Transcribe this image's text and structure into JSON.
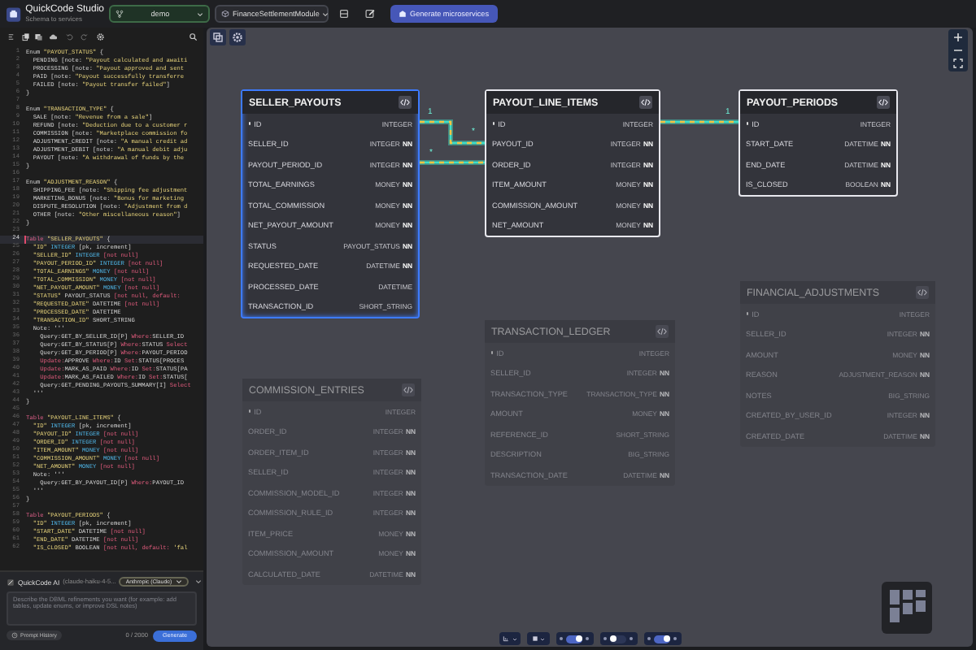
{
  "app": {
    "title": "QuickCode Studio",
    "subtitle": "Schema to services"
  },
  "topbar": {
    "branch": "demo",
    "module": "FinanceSettlementModule",
    "generate_button": "Generate microservices"
  },
  "code_lines": [
    {
      "n": "1",
      "current": false,
      "s": [
        {
          "text": "Enum ",
          "kind": "plain"
        },
        {
          "text": "\"PAYOUT_STATUS\"",
          "kind": "string"
        },
        {
          "text": " {",
          "kind": "plain"
        }
      ]
    },
    {
      "n": "2",
      "current": false,
      "s": [
        {
          "text": "  PENDING [note: ",
          "kind": "plain"
        },
        {
          "text": "\"Payout calculated and awaiti",
          "kind": "string"
        }
      ]
    },
    {
      "n": "3",
      "current": false,
      "s": [
        {
          "text": "  PROCESSING [note: ",
          "kind": "plain"
        },
        {
          "text": "\"Payout approved and sent",
          "kind": "string"
        }
      ]
    },
    {
      "n": "4",
      "current": false,
      "s": [
        {
          "text": "  PAID [note: ",
          "kind": "plain"
        },
        {
          "text": "\"Payout successfully transferre",
          "kind": "string"
        }
      ]
    },
    {
      "n": "5",
      "current": false,
      "s": [
        {
          "text": "  FAILED [note: ",
          "kind": "plain"
        },
        {
          "text": "\"Payout transfer failed\"",
          "kind": "string"
        },
        {
          "text": "]",
          "kind": "plain"
        }
      ]
    },
    {
      "n": "6",
      "current": false,
      "s": [
        {
          "text": "}",
          "kind": "plain"
        }
      ]
    },
    {
      "n": "7",
      "current": false
    },
    {
      "n": "8",
      "current": false,
      "s": [
        {
          "text": "Enum ",
          "kind": "plain"
        },
        {
          "text": "\"TRANSACTION_TYPE\"",
          "kind": "string"
        },
        {
          "text": " {",
          "kind": "plain"
        }
      ]
    },
    {
      "n": "9",
      "current": false,
      "s": [
        {
          "text": "  SALE [note: ",
          "kind": "plain"
        },
        {
          "text": "\"Revenue from a sale\"",
          "kind": "string"
        },
        {
          "text": "]",
          "kind": "plain"
        }
      ]
    },
    {
      "n": "10",
      "current": false,
      "s": [
        {
          "text": "  REFUND [note: ",
          "kind": "plain"
        },
        {
          "text": "\"Deduction due to a customer r",
          "kind": "string"
        }
      ]
    },
    {
      "n": "11",
      "current": false,
      "s": [
        {
          "text": "  COMMISSION [note: ",
          "kind": "plain"
        },
        {
          "text": "\"Marketplace commission fo",
          "kind": "string"
        }
      ]
    },
    {
      "n": "12",
      "current": false,
      "s": [
        {
          "text": "  ADJUSTMENT_CREDIT [note: ",
          "kind": "plain"
        },
        {
          "text": "\"A manual credit ad",
          "kind": "string"
        }
      ]
    },
    {
      "n": "13",
      "current": false,
      "s": [
        {
          "text": "  ADJUSTMENT_DEBIT [note: ",
          "kind": "plain"
        },
        {
          "text": "\"A manual debit adju",
          "kind": "string"
        }
      ]
    },
    {
      "n": "14",
      "current": false,
      "s": [
        {
          "text": "  PAYOUT [note: ",
          "kind": "plain"
        },
        {
          "text": "\"A withdrawal of funds by the",
          "kind": "string"
        }
      ]
    },
    {
      "n": "15",
      "current": false,
      "s": [
        {
          "text": "}",
          "kind": "plain"
        }
      ]
    },
    {
      "n": "16",
      "current": false
    },
    {
      "n": "17",
      "current": false,
      "s": [
        {
          "text": "Enum ",
          "kind": "plain"
        },
        {
          "text": "\"ADJUSTMENT_REASON\"",
          "kind": "string"
        },
        {
          "text": " {",
          "kind": "plain"
        }
      ]
    },
    {
      "n": "18",
      "current": false,
      "s": [
        {
          "text": "  SHIPPING_FEE [note: ",
          "kind": "plain"
        },
        {
          "text": "\"Shipping fee adjustment",
          "kind": "string"
        }
      ]
    },
    {
      "n": "19",
      "current": false,
      "s": [
        {
          "text": "  MARKETING_BONUS [note: ",
          "kind": "plain"
        },
        {
          "text": "\"Bonus for marketing",
          "kind": "string"
        }
      ]
    },
    {
      "n": "20",
      "current": false,
      "s": [
        {
          "text": "  DISPUTE_RESOLUTION [note: ",
          "kind": "plain"
        },
        {
          "text": "\"Adjustment from d",
          "kind": "string"
        }
      ]
    },
    {
      "n": "21",
      "current": false,
      "s": [
        {
          "text": "  OTHER [note: ",
          "kind": "plain"
        },
        {
          "text": "\"Other miscellaneous reason\"",
          "kind": "string"
        },
        {
          "text": "]",
          "kind": "plain"
        }
      ]
    },
    {
      "n": "22",
      "current": false,
      "s": [
        {
          "text": "}",
          "kind": "plain"
        }
      ]
    },
    {
      "n": "23",
      "current": false
    },
    {
      "n": "24",
      "current": true,
      "s": [
        {
          "text": "Table ",
          "kind": "keyword"
        },
        {
          "text": "\"SELLER_PAYOUTS\"",
          "kind": "string"
        },
        {
          "text": " {",
          "kind": "plain"
        }
      ]
    },
    {
      "n": "25",
      "current": false,
      "s": [
        {
          "text": "  \"ID\" ",
          "kind": "string"
        },
        {
          "text": "INTEGER",
          "kind": "type"
        },
        {
          "text": " [pk, increment]",
          "kind": "plain"
        }
      ]
    },
    {
      "n": "26",
      "current": false,
      "s": [
        {
          "text": "  \"SELLER_ID\" ",
          "kind": "string"
        },
        {
          "text": "INTEGER",
          "kind": "type"
        },
        {
          "text": " [not null]",
          "kind": "constraint"
        }
      ]
    },
    {
      "n": "27",
      "current": false,
      "s": [
        {
          "text": "  \"PAYOUT_PERIOD_ID\" ",
          "kind": "string"
        },
        {
          "text": "INTEGER",
          "kind": "type"
        },
        {
          "text": " [not null]",
          "kind": "constraint"
        }
      ]
    },
    {
      "n": "28",
      "current": false,
      "s": [
        {
          "text": "  \"TOTAL_EARNINGS\" ",
          "kind": "string"
        },
        {
          "text": "MONEY",
          "kind": "type"
        },
        {
          "text": " [not null]",
          "kind": "constraint"
        }
      ]
    },
    {
      "n": "29",
      "current": false,
      "s": [
        {
          "text": "  \"TOTAL_COMMISSION\" ",
          "kind": "string"
        },
        {
          "text": "MONEY",
          "kind": "type"
        },
        {
          "text": " [not null]",
          "kind": "constraint"
        }
      ]
    },
    {
      "n": "30",
      "current": false,
      "s": [
        {
          "text": "  \"NET_PAYOUT_AMOUNT\" ",
          "kind": "string"
        },
        {
          "text": "MONEY",
          "kind": "type"
        },
        {
          "text": " [not null]",
          "kind": "constraint"
        }
      ]
    },
    {
      "n": "31",
      "current": false,
      "s": [
        {
          "text": "  \"STATUS\" ",
          "kind": "string"
        },
        {
          "text": "PAYOUT_STATUS",
          "kind": "plain"
        },
        {
          "text": " [not null, default:",
          "kind": "constraint"
        }
      ]
    },
    {
      "n": "32",
      "current": false,
      "s": [
        {
          "text": "  \"REQUESTED_DATE\" ",
          "kind": "string"
        },
        {
          "text": "DATETIME",
          "kind": "plain"
        },
        {
          "text": " [not null]",
          "kind": "constraint"
        }
      ]
    },
    {
      "n": "33",
      "current": false,
      "s": [
        {
          "text": "  \"PROCESSED_DATE\" ",
          "kind": "string"
        },
        {
          "text": "DATETIME",
          "kind": "plain"
        }
      ]
    },
    {
      "n": "34",
      "current": false,
      "s": [
        {
          "text": "  \"TRANSACTION_ID\" ",
          "kind": "string"
        },
        {
          "text": "SHORT_STRING",
          "kind": "plain"
        }
      ]
    },
    {
      "n": "35",
      "current": false,
      "s": [
        {
          "text": "  Note: '''",
          "kind": "plain"
        }
      ]
    },
    {
      "n": "36",
      "current": false,
      "s": [
        {
          "text": "    Query:GET_BY_SELLER_ID[P] ",
          "kind": "plain"
        },
        {
          "text": "Where:",
          "kind": "constraint"
        },
        {
          "text": "SELLER_ID",
          "kind": "plain"
        }
      ]
    },
    {
      "n": "37",
      "current": false,
      "s": [
        {
          "text": "    Query:GET_BY_STATUS[P] ",
          "kind": "plain"
        },
        {
          "text": "Where:",
          "kind": "constraint"
        },
        {
          "text": "STATUS ",
          "kind": "plain"
        },
        {
          "text": "Select",
          "kind": "constraint"
        }
      ]
    },
    {
      "n": "38",
      "current": false,
      "s": [
        {
          "text": "    Query:GET_BY_PERIOD[P] ",
          "kind": "plain"
        },
        {
          "text": "Where:",
          "kind": "constraint"
        },
        {
          "text": "PAYOUT_PERIOD",
          "kind": "plain"
        }
      ]
    },
    {
      "n": "39",
      "current": false,
      "s": [
        {
          "text": "    Update:",
          "kind": "constraint"
        },
        {
          "text": "APPROVE ",
          "kind": "plain"
        },
        {
          "text": "Where:",
          "kind": "constraint"
        },
        {
          "text": "ID ",
          "kind": "plain"
        },
        {
          "text": "Set:",
          "kind": "constraint"
        },
        {
          "text": "STATUS[PROCES",
          "kind": "plain"
        }
      ]
    },
    {
      "n": "40",
      "current": false,
      "s": [
        {
          "text": "    Update:",
          "kind": "constraint"
        },
        {
          "text": "MARK_AS_PAID ",
          "kind": "plain"
        },
        {
          "text": "Where:",
          "kind": "constraint"
        },
        {
          "text": "ID ",
          "kind": "plain"
        },
        {
          "text": "Set:",
          "kind": "constraint"
        },
        {
          "text": "STATUS[PA",
          "kind": "plain"
        }
      ]
    },
    {
      "n": "41",
      "current": false,
      "s": [
        {
          "text": "    Update:",
          "kind": "constraint"
        },
        {
          "text": "MARK_AS_FAILED ",
          "kind": "plain"
        },
        {
          "text": "Where:",
          "kind": "constraint"
        },
        {
          "text": "ID ",
          "kind": "plain"
        },
        {
          "text": "Set:",
          "kind": "constraint"
        },
        {
          "text": "STATUS[",
          "kind": "plain"
        }
      ]
    },
    {
      "n": "42",
      "current": false,
      "s": [
        {
          "text": "    Query:GET_PENDING_PAYOUTS_SUMMARY[I] ",
          "kind": "plain"
        },
        {
          "text": "Select",
          "kind": "constraint"
        }
      ]
    },
    {
      "n": "43",
      "current": false,
      "s": [
        {
          "text": "  '''",
          "kind": "plain"
        }
      ]
    },
    {
      "n": "44",
      "current": false,
      "s": [
        {
          "text": "}",
          "kind": "plain"
        }
      ]
    },
    {
      "n": "45",
      "current": false
    },
    {
      "n": "46",
      "current": false,
      "s": [
        {
          "text": "Table ",
          "kind": "keyword"
        },
        {
          "text": "\"PAYOUT_LINE_ITEMS\"",
          "kind": "string"
        },
        {
          "text": " {",
          "kind": "plain"
        }
      ]
    },
    {
      "n": "47",
      "current": false,
      "s": [
        {
          "text": "  \"ID\" ",
          "kind": "string"
        },
        {
          "text": "INTEGER",
          "kind": "type"
        },
        {
          "text": " [pk, increment]",
          "kind": "plain"
        }
      ]
    },
    {
      "n": "48",
      "current": false,
      "s": [
        {
          "text": "  \"PAYOUT_ID\" ",
          "kind": "string"
        },
        {
          "text": "INTEGER",
          "kind": "type"
        },
        {
          "text": " [not null]",
          "kind": "constraint"
        }
      ]
    },
    {
      "n": "49",
      "current": false,
      "s": [
        {
          "text": "  \"ORDER_ID\" ",
          "kind": "string"
        },
        {
          "text": "INTEGER",
          "kind": "type"
        },
        {
          "text": " [not null]",
          "kind": "constraint"
        }
      ]
    },
    {
      "n": "50",
      "current": false,
      "s": [
        {
          "text": "  \"ITEM_AMOUNT\" ",
          "kind": "string"
        },
        {
          "text": "MONEY",
          "kind": "type"
        },
        {
          "text": " [not null]",
          "kind": "constraint"
        }
      ]
    },
    {
      "n": "51",
      "current": false,
      "s": [
        {
          "text": "  \"COMMISSION_AMOUNT\" ",
          "kind": "string"
        },
        {
          "text": "MONEY",
          "kind": "type"
        },
        {
          "text": " [not null]",
          "kind": "constraint"
        }
      ]
    },
    {
      "n": "52",
      "current": false,
      "s": [
        {
          "text": "  \"NET_AMOUNT\" ",
          "kind": "string"
        },
        {
          "text": "MONEY",
          "kind": "type"
        },
        {
          "text": " [not null]",
          "kind": "constraint"
        }
      ]
    },
    {
      "n": "53",
      "current": false,
      "s": [
        {
          "text": "  Note: '''",
          "kind": "plain"
        }
      ]
    },
    {
      "n": "54",
      "current": false,
      "s": [
        {
          "text": "    Query:GET_BY_PAYOUT_ID[P] ",
          "kind": "plain"
        },
        {
          "text": "Where:",
          "kind": "constraint"
        },
        {
          "text": "PAYOUT_ID",
          "kind": "plain"
        }
      ]
    },
    {
      "n": "55",
      "current": false,
      "s": [
        {
          "text": "  '''",
          "kind": "plain"
        }
      ]
    },
    {
      "n": "56",
      "current": false,
      "s": [
        {
          "text": "}",
          "kind": "plain"
        }
      ]
    },
    {
      "n": "57",
      "current": false
    },
    {
      "n": "58",
      "current": false,
      "s": [
        {
          "text": "Table ",
          "kind": "keyword"
        },
        {
          "text": "\"PAYOUT_PERIODS\"",
          "kind": "string"
        },
        {
          "text": " {",
          "kind": "plain"
        }
      ]
    },
    {
      "n": "59",
      "current": false,
      "s": [
        {
          "text": "  \"ID\" ",
          "kind": "string"
        },
        {
          "text": "INTEGER",
          "kind": "type"
        },
        {
          "text": " [pk, increment]",
          "kind": "plain"
        }
      ]
    },
    {
      "n": "60",
      "current": false,
      "s": [
        {
          "text": "  \"START_DATE\" ",
          "kind": "string"
        },
        {
          "text": "DATETIME",
          "kind": "plain"
        },
        {
          "text": " [not null]",
          "kind": "constraint"
        }
      ]
    },
    {
      "n": "61",
      "current": false,
      "s": [
        {
          "text": "  \"END_DATE\" ",
          "kind": "string"
        },
        {
          "text": "DATETIME",
          "kind": "plain"
        },
        {
          "text": " [not null]",
          "kind": "constraint"
        }
      ]
    },
    {
      "n": "62",
      "current": false,
      "s": [
        {
          "text": "  \"IS_CLOSED\" ",
          "kind": "string"
        },
        {
          "text": "BOOLEAN",
          "kind": "plain"
        },
        {
          "text": " [not null, default: ",
          "kind": "constraint"
        },
        {
          "text": "'fal",
          "kind": "string"
        }
      ]
    }
  ],
  "ai_panel": {
    "title": "QuickCode AI",
    "model": "(claude-haiku-4-5...",
    "provider": "Anthropic (Claude)",
    "placeholder": "Describe the DBML refinements you want (for example: add tables, update enums, or improve DSL notes)",
    "history_button": "Prompt History",
    "counter": "0 / 2000",
    "generate_button": "Generate"
  },
  "tables": [
    {
      "name": "SELLER_PAYOUTS",
      "selected": true,
      "dimmed": false,
      "columns": [
        {
          "name": "ID",
          "type": "INTEGER",
          "pk": true
        },
        {
          "name": "SELLER_ID",
          "type": "INTEGER",
          "constraint": "NN",
          "pk": false
        },
        {
          "name": "PAYOUT_PERIOD_ID",
          "type": "INTEGER",
          "constraint": "NN",
          "pk": false
        },
        {
          "name": "TOTAL_EARNINGS",
          "type": "MONEY",
          "constraint": "NN",
          "pk": false
        },
        {
          "name": "TOTAL_COMMISSION",
          "type": "MONEY",
          "constraint": "NN",
          "pk": false
        },
        {
          "name": "NET_PAYOUT_AMOUNT",
          "type": "MONEY",
          "constraint": "NN",
          "pk": false
        },
        {
          "name": "STATUS",
          "type": "PAYOUT_STATUS",
          "constraint": "NN",
          "pk": false
        },
        {
          "name": "REQUESTED_DATE",
          "type": "DATETIME",
          "constraint": "NN",
          "pk": false
        },
        {
          "name": "PROCESSED_DATE",
          "type": "DATETIME",
          "pk": false
        },
        {
          "name": "TRANSACTION_ID",
          "type": "SHORT_STRING",
          "pk": false
        }
      ]
    },
    {
      "name": "PAYOUT_LINE_ITEMS",
      "selected": false,
      "dimmed": false,
      "columns": [
        {
          "name": "ID",
          "type": "INTEGER",
          "pk": true
        },
        {
          "name": "PAYOUT_ID",
          "type": "INTEGER",
          "constraint": "NN",
          "pk": false
        },
        {
          "name": "ORDER_ID",
          "type": "INTEGER",
          "constraint": "NN",
          "pk": false
        },
        {
          "name": "ITEM_AMOUNT",
          "type": "MONEY",
          "constraint": "NN",
          "pk": false
        },
        {
          "name": "COMMISSION_AMOUNT",
          "type": "MONEY",
          "constraint": "NN",
          "pk": false
        },
        {
          "name": "NET_AMOUNT",
          "type": "MONEY",
          "constraint": "NN",
          "pk": false
        }
      ]
    },
    {
      "name": "PAYOUT_PERIODS",
      "selected": false,
      "dimmed": false,
      "columns": [
        {
          "name": "ID",
          "type": "INTEGER",
          "pk": true
        },
        {
          "name": "START_DATE",
          "type": "DATETIME",
          "constraint": "NN",
          "pk": false
        },
        {
          "name": "END_DATE",
          "type": "DATETIME",
          "constraint": "NN",
          "pk": false
        },
        {
          "name": "IS_CLOSED",
          "type": "BOOLEAN",
          "constraint": "NN",
          "pk": false
        }
      ]
    },
    {
      "name": "FINANCIAL_ADJUSTMENTS",
      "selected": false,
      "dimmed": true,
      "columns": [
        {
          "name": "ID",
          "type": "INTEGER",
          "pk": true
        },
        {
          "name": "SELLER_ID",
          "type": "INTEGER",
          "constraint": "NN",
          "pk": false
        },
        {
          "name": "AMOUNT",
          "type": "MONEY",
          "constraint": "NN",
          "pk": false
        },
        {
          "name": "REASON",
          "type": "ADJUSTMENT_REASON",
          "constraint": "NN",
          "pk": false
        },
        {
          "name": "NOTES",
          "type": "BIG_STRING",
          "pk": false
        },
        {
          "name": "CREATED_BY_USER_ID",
          "type": "INTEGER",
          "constraint": "NN",
          "pk": false
        },
        {
          "name": "CREATED_DATE",
          "type": "DATETIME",
          "constraint": "NN",
          "pk": false
        }
      ]
    },
    {
      "name": "TRANSACTION_LEDGER",
      "selected": false,
      "dimmed": true,
      "columns": [
        {
          "name": "ID",
          "type": "INTEGER",
          "pk": true
        },
        {
          "name": "SELLER_ID",
          "type": "INTEGER",
          "constraint": "NN",
          "pk": false
        },
        {
          "name": "TRANSACTION_TYPE",
          "type": "TRANSACTION_TYPE",
          "constraint": "NN",
          "pk": false
        },
        {
          "name": "AMOUNT",
          "type": "MONEY",
          "constraint": "NN",
          "pk": false
        },
        {
          "name": "REFERENCE_ID",
          "type": "SHORT_STRING",
          "pk": false
        },
        {
          "name": "DESCRIPTION",
          "type": "BIG_STRING",
          "pk": false
        },
        {
          "name": "TRANSACTION_DATE",
          "type": "DATETIME",
          "constraint": "NN",
          "pk": false
        }
      ]
    },
    {
      "name": "COMMISSION_ENTRIES",
      "selected": false,
      "dimmed": true,
      "columns": [
        {
          "name": "ID",
          "type": "INTEGER",
          "pk": true
        },
        {
          "name": "ORDER_ID",
          "type": "INTEGER",
          "constraint": "NN",
          "pk": false
        },
        {
          "name": "ORDER_ITEM_ID",
          "type": "INTEGER",
          "constraint": "NN",
          "pk": false
        },
        {
          "name": "SELLER_ID",
          "type": "INTEGER",
          "constraint": "NN",
          "pk": false
        },
        {
          "name": "COMMISSION_MODEL_ID",
          "type": "INTEGER",
          "constraint": "NN",
          "pk": false
        },
        {
          "name": "COMMISSION_RULE_ID",
          "type": "INTEGER",
          "constraint": "NN",
          "pk": false
        },
        {
          "name": "ITEM_PRICE",
          "type": "MONEY",
          "constraint": "NN",
          "pk": false
        },
        {
          "name": "COMMISSION_AMOUNT",
          "type": "MONEY",
          "constraint": "NN",
          "pk": false
        },
        {
          "name": "CALCULATED_DATE",
          "type": "DATETIME",
          "constraint": "NN",
          "pk": false
        }
      ]
    }
  ],
  "relations": [
    {
      "from_label": "1",
      "to_label": "*"
    },
    {
      "from_label": "*",
      "to_label": "1"
    }
  ],
  "bottom_toolbar": {
    "toggles": [
      {
        "on": true
      },
      {
        "on": false
      },
      {
        "on": true
      }
    ]
  }
}
